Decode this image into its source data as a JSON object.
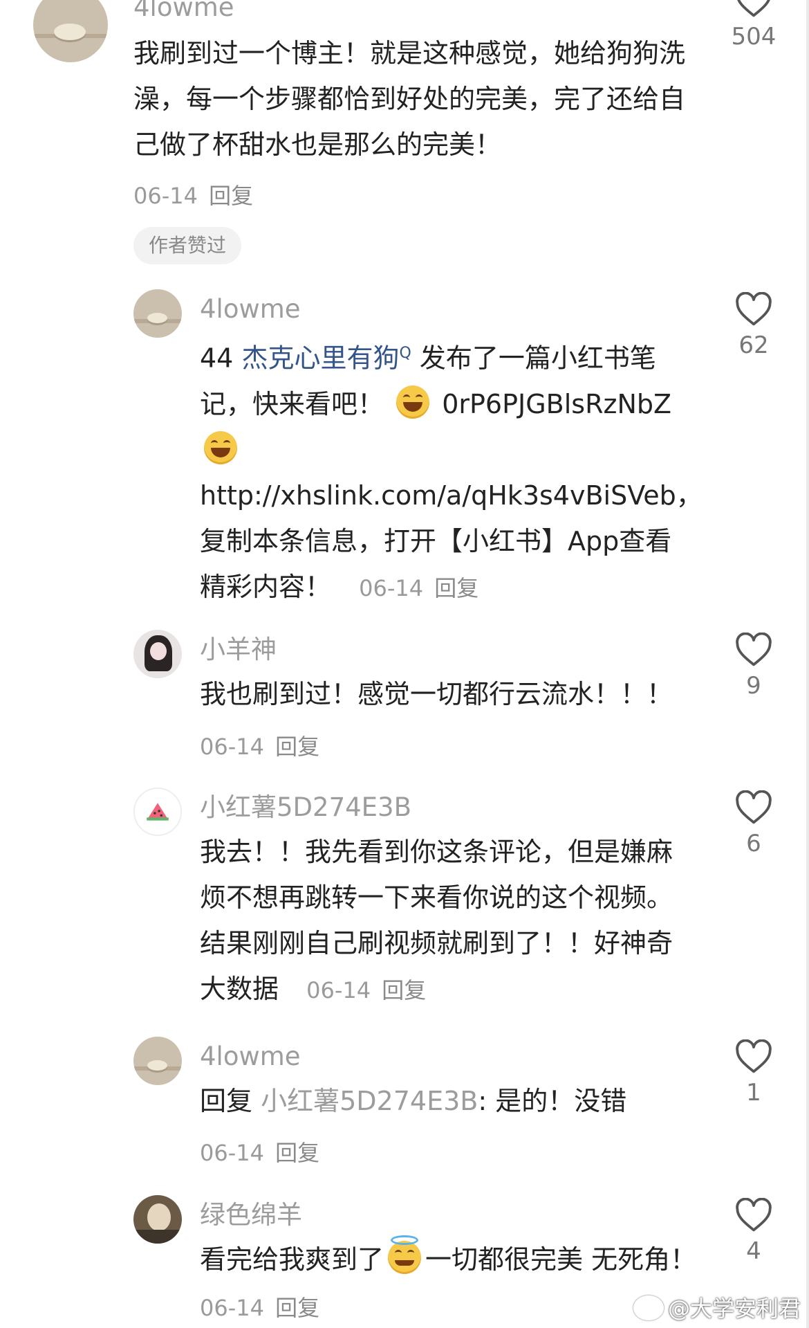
{
  "comments": [
    {
      "username": "4lowme",
      "text": "我刷到过一个博主！就是这种感觉，她给狗狗洗澡，每一个步骤都恰到好处的完美，完了还给自己做了杯甜水也是那么的完美！",
      "date": "06-14",
      "reply_label": "回复",
      "likes": "504",
      "author_badge": "作者赞过"
    },
    {
      "username": "4lowme",
      "text_prefix": "44",
      "mention": "杰克心里有狗",
      "mention_sup": "Q",
      "text_part1": "发布了一篇小红书笔记，快来看吧！",
      "text_code": "0rP6PJGBlsRzNbZ",
      "text_part2": "http://xhslink.com/a/qHk3s4vBiSVeb，复制本条信息，打开【小红书】App查看精彩内容！",
      "date": "06-14",
      "reply_label": "回复",
      "likes": "62"
    },
    {
      "username": "小羊神",
      "text": "我也刷到过！感觉一切都行云流水！！！",
      "date": "06-14",
      "reply_label": "回复",
      "likes": "9"
    },
    {
      "username": "小红薯5D274E3B",
      "text": "我去！！我先看到你这条评论，但是嫌麻烦不想再跳转一下来看你说的这个视频。结果刚刚自己刷视频就刷到了！！好神奇大数据",
      "date": "06-14",
      "reply_label": "回复",
      "likes": "6"
    },
    {
      "username": "4lowme",
      "reply_prefix": "回复",
      "reply_target": "小红薯5D274E3B",
      "text": ": 是的！没错",
      "date": "06-14",
      "reply_label": "回复",
      "likes": "1"
    },
    {
      "username": "绿色绵羊",
      "text_part1": "看完给我爽到了",
      "text_part2": "一切都很完美 无死角！",
      "date": "06-14",
      "reply_label": "回复",
      "likes": "4"
    }
  ],
  "watermark": "@大学安利君",
  "icons": {
    "like": "heart-outline-icon",
    "emoji_laugh": "grinning-squinting-face-icon",
    "emoji_angel": "smiling-face-with-halo-icon",
    "watermark": "weibo-logo-icon"
  },
  "colors": {
    "username": "#9c9c9c",
    "mention": "#33558a",
    "meta": "#9a9a9a",
    "text": "#222222"
  }
}
